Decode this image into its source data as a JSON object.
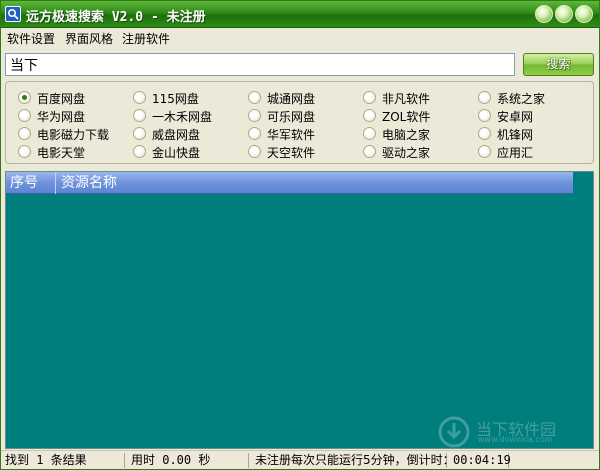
{
  "window": {
    "title": "远方极速搜索 V2.0 - 未注册"
  },
  "menu": {
    "items": [
      "软件设置",
      "界面风格",
      "注册软件"
    ]
  },
  "search": {
    "value": "当下",
    "button_label": "搜索"
  },
  "sources": {
    "selected": "百度网盘",
    "columns": [
      [
        "百度网盘",
        "华为网盘",
        "电影磁力下载",
        "电影天堂"
      ],
      [
        "115网盘",
        "一木禾网盘",
        "威盘网盘",
        "金山快盘"
      ],
      [
        "城通网盘",
        "可乐网盘",
        "华军软件",
        "天空软件"
      ],
      [
        "非凡软件",
        "ZOL软件",
        "电脑之家",
        "驱动之家"
      ],
      [
        "系统之家",
        "安卓网",
        "机锋网",
        "应用汇"
      ]
    ]
  },
  "results": {
    "columns": [
      "序号",
      "资源名称"
    ],
    "rows": []
  },
  "watermark": {
    "text": "当下软件园",
    "sub": "www.downxia.com"
  },
  "status": {
    "found": "找到 1 条结果",
    "elapsed": "用时 0.00 秒",
    "notice": "未注册每次只能运行5分钟，倒计时：",
    "countdown": "00:04:19"
  },
  "colors": {
    "titlebar": "#2f8a16",
    "list_background": "#007D7D",
    "header": "#6f93dc",
    "face": "#ECE9D8"
  }
}
